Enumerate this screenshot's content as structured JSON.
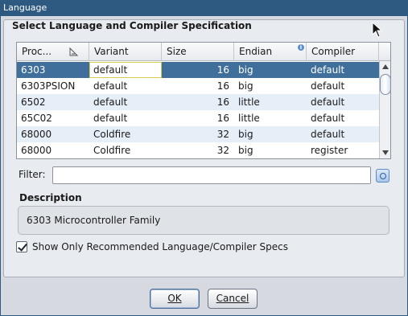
{
  "window": {
    "title": "Language"
  },
  "panel": {
    "title": "Select Language and Compiler Specification"
  },
  "table": {
    "columns": [
      "Proc...",
      "Variant",
      "Size",
      "Endian",
      "Compiler"
    ],
    "rows": [
      [
        "6303",
        "default",
        "16",
        "big",
        "default"
      ],
      [
        "6303PSION",
        "default",
        "16",
        "big",
        "default"
      ],
      [
        "6502",
        "default",
        "16",
        "little",
        "default"
      ],
      [
        "65C02",
        "default",
        "16",
        "little",
        "default"
      ],
      [
        "68000",
        "Coldfire",
        "32",
        "big",
        "default"
      ],
      [
        "68000",
        "Coldfire",
        "32",
        "big",
        "register"
      ]
    ],
    "selected_row": 0
  },
  "filter": {
    "label": "Filter:",
    "value": ""
  },
  "description": {
    "title": "Description",
    "text": "6303 Microcontroller Family"
  },
  "recommended_checkbox": {
    "label": "Show Only Recommended Language/Compiler Specs",
    "checked": true
  },
  "buttons": {
    "ok": "OK",
    "cancel": "Cancel"
  },
  "colors": {
    "titlebar": "#2e5a82",
    "selection": "#3f6f9a",
    "row_alt": "#e6eef8"
  },
  "icons": {
    "sort": "sort-triangle-icon",
    "info": "info-icon",
    "filter_action": "filter-clear-icon",
    "cursor": "mouse-cursor-icon"
  }
}
